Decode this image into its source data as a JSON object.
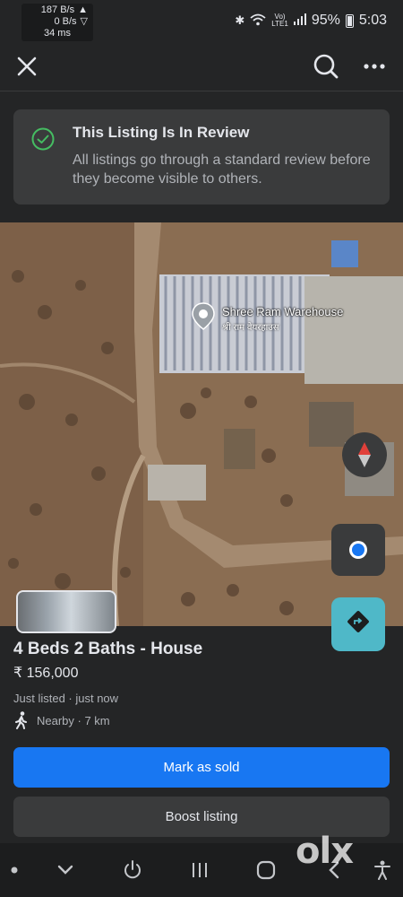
{
  "status_bar": {
    "net_up": "187 B/s",
    "net_down": "0 B/s",
    "latency": "34 ms",
    "battery": "95%",
    "time": "5:03",
    "icons": [
      "bluetooth-icon",
      "wifi-icon",
      "volte-icon",
      "signal-icon",
      "battery-icon"
    ]
  },
  "toolbar": {
    "close_icon": "close-icon",
    "search_icon": "search-icon",
    "more_icon": "more-icon"
  },
  "review_banner": {
    "title": "This Listing Is In Review",
    "description": "All listings go through a standard review before they become visible to others."
  },
  "map": {
    "place_label": "Shree Ram Warehouse",
    "place_label_local": "श्री राम वेयरहाउस"
  },
  "listing": {
    "title": "4 Beds 2 Baths - House",
    "price": "₹ 156,000",
    "status": "Just listed · just now",
    "distance": "Nearby · 7 km"
  },
  "actions": {
    "mark_sold": "Mark as sold",
    "boost": "Boost listing"
  },
  "watermark": "OLX",
  "colors": {
    "accent": "#1877f2",
    "success": "#45bd62",
    "background": "#242526",
    "surface": "#3a3b3c"
  }
}
